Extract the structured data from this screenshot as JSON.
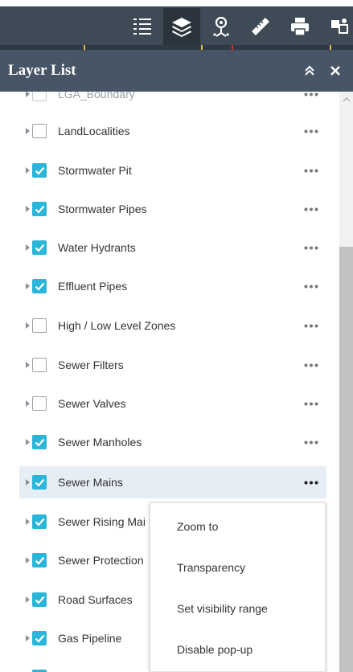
{
  "header": {
    "title": "Layer List"
  },
  "layers": [
    {
      "label": "LGA_Boundary",
      "checked": false,
      "faded": true
    },
    {
      "label": "LandLocalities",
      "checked": false
    },
    {
      "label": "Stormwater Pit",
      "checked": true
    },
    {
      "label": "Stormwater Pipes",
      "checked": true
    },
    {
      "label": "Water Hydrants",
      "checked": true
    },
    {
      "label": "Effluent Pipes",
      "checked": true
    },
    {
      "label": "High / Low Level Zones",
      "checked": false
    },
    {
      "label": "Sewer Filters",
      "checked": false
    },
    {
      "label": "Sewer Valves",
      "checked": false
    },
    {
      "label": "Sewer Manholes",
      "checked": true
    },
    {
      "label": "Sewer Mains",
      "checked": true,
      "selected": true
    },
    {
      "label": "Sewer Rising Mains",
      "checked": true
    },
    {
      "label": "Sewer Protection",
      "checked": true
    },
    {
      "label": "Road Surfaces",
      "checked": true
    },
    {
      "label": "Gas Pipeline",
      "checked": true
    },
    {
      "label": "",
      "checked": true
    }
  ],
  "menu": {
    "items": [
      {
        "label": "Zoom to",
        "highlighted": true
      },
      {
        "label": "Transparency",
        "highlighted": false
      },
      {
        "label": "Set visibility range",
        "highlighted": false
      },
      {
        "label": "Disable pop-up",
        "highlighted": true
      }
    ]
  },
  "colors": {
    "toolbar": "#3f4a57",
    "header": "#485566",
    "accent": "#29b6d9",
    "selected_row": "#e6edf5"
  },
  "icons": [
    "legend-icon",
    "layer-list-icon",
    "directions-icon",
    "measure-icon",
    "print-icon",
    "basemap-gallery-icon",
    "collapse-all-icon",
    "close-icon"
  ]
}
